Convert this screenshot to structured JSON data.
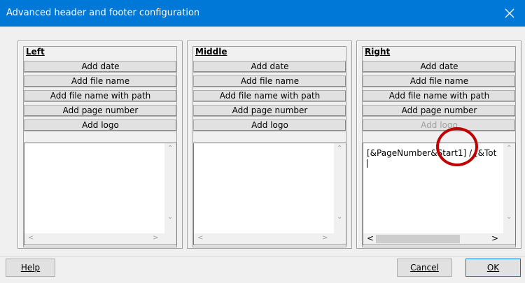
{
  "window": {
    "title": "Advanced header and footer configuration",
    "close_glyph": "close-icon"
  },
  "panels": [
    {
      "label": "Left",
      "buttons": [
        "Add date",
        "Add file name",
        "Add file name with path",
        "Add page number",
        "Add logo"
      ],
      "logo_enabled": true,
      "text": ""
    },
    {
      "label": "Middle",
      "buttons": [
        "Add date",
        "Add file name",
        "Add file name with path",
        "Add page number",
        "Add logo"
      ],
      "logo_enabled": true,
      "text": ""
    },
    {
      "label": "Right",
      "buttons": [
        "Add date",
        "Add file name",
        "Add file name with path",
        "Add page number",
        "Add logo"
      ],
      "logo_enabled": false,
      "text": "[&PageNumber&Start1] / [&Tot"
    }
  ],
  "footer": {
    "help": "Help",
    "cancel": "Cancel",
    "ok": "OK"
  },
  "colors": {
    "titlebar": "#0078d7",
    "annotation_ring": "#c00000"
  }
}
